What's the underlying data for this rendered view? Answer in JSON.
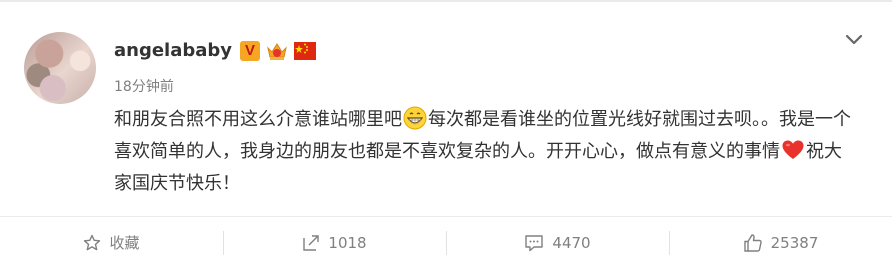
{
  "post": {
    "username": "angelababy",
    "time": "18分钟前",
    "content_part1": "和朋友合照不用这么介意谁站哪里吧",
    "content_part2": "每次都是看谁坐的位置光线好就围过去呗。。我是一个喜欢简单的人，我身边的朋友也都是不喜欢复杂的人。开开心心，做点有意义的事情",
    "content_part3": "祝大家国庆节快乐！",
    "verified_badge": "V",
    "icons": [
      "verified-badge-icon",
      "crown-badge-icon",
      "china-flag-icon",
      "chevron-down-icon",
      "grin-emoji-icon",
      "heart-emoji-icon"
    ]
  },
  "actions": {
    "favorite_label": "收藏",
    "repost_count": "1018",
    "comment_count": "4470",
    "like_count": "25387"
  },
  "colors": {
    "text": "#333333",
    "muted": "#808080",
    "verified": "#f5a623",
    "heart": "#e8322b"
  }
}
